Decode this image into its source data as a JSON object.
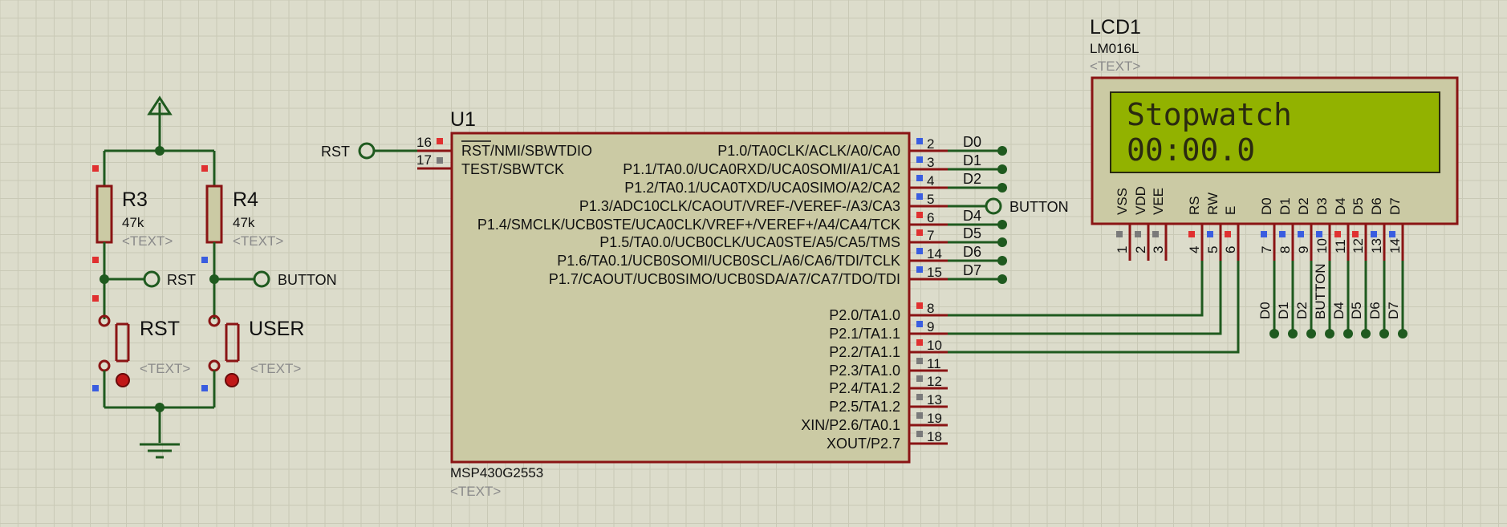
{
  "colors": {
    "background": "#dcdccb",
    "grid": "#c9c9b6",
    "wire": "#1f5a1f",
    "component_outline": "#8a1414",
    "component_body": "#cbcaa4",
    "lcd_screen": "#92b200",
    "lcd_text": "#2a2a10",
    "pin_red": "#e03030",
    "pin_blue": "#3a5de0",
    "pin_gray": "#7a7a7a"
  },
  "power_terminal_icon": "up-arrow-icon",
  "ground_icon": "ground-icon",
  "resistors": [
    {
      "ref": "R3",
      "value": "47k",
      "text_placeholder": "<TEXT>"
    },
    {
      "ref": "R4",
      "value": "47k",
      "text_placeholder": "<TEXT>"
    }
  ],
  "buttons": [
    {
      "ref": "RST",
      "text_placeholder": "<TEXT>"
    },
    {
      "ref": "USER",
      "text_placeholder": "<TEXT>"
    }
  ],
  "left_terminals": [
    {
      "label": "RST"
    },
    {
      "label": "BUTTON"
    }
  ],
  "mcu": {
    "ref": "U1",
    "part": "MSP430G2553",
    "text_placeholder": "<TEXT>",
    "input_terminal": "RST",
    "left_pins": [
      {
        "num": "16",
        "name": "RST/NMI/SBWTDIO",
        "overline": "RST",
        "rest": "/NMI/SBWTDIO"
      },
      {
        "num": "17",
        "name": "TEST/SBWTCK"
      }
    ],
    "right_pins": [
      {
        "num": "2",
        "name": "P1.0/TA0CLK/ACLK/A0/CA0",
        "net": "D0"
      },
      {
        "num": "3",
        "name": "P1.1/TA0.0/UCA0RXD/UCA0SOMI/A1/CA1",
        "net": "D1"
      },
      {
        "num": "4",
        "name": "P1.2/TA0.1/UCA0TXD/UCA0SIMO/A2/CA2",
        "net": "D2"
      },
      {
        "num": "5",
        "name": "P1.3/ADC10CLK/CAOUT/VREF-/VEREF-/A3/CA3",
        "net": "BUTTON"
      },
      {
        "num": "6",
        "name": "P1.4/SMCLK/UCB0STE/UCA0CLK/VREF+/VEREF+/A4/CA4/TCK",
        "net": "D4"
      },
      {
        "num": "7",
        "name": "P1.5/TA0.0/UCB0CLK/UCA0STE/A5/CA5/TMS",
        "net": "D5"
      },
      {
        "num": "14",
        "name": "P1.6/TA0.1/UCB0SOMI/UCB0SCL/A6/CA6/TDI/TCLK",
        "net": "D6"
      },
      {
        "num": "15",
        "name": "P1.7/CAOUT/UCB0SIMO/UCB0SDA/A7/CA7/TDO/TDI",
        "net": "D7"
      },
      {
        "num": "8",
        "name": "P2.0/TA1.0",
        "net": ""
      },
      {
        "num": "9",
        "name": "P2.1/TA1.1",
        "net": ""
      },
      {
        "num": "10",
        "name": "P2.2/TA1.1",
        "net": ""
      },
      {
        "num": "11",
        "name": "P2.3/TA1.0",
        "net": ""
      },
      {
        "num": "12",
        "name": "P2.4/TA1.2",
        "net": ""
      },
      {
        "num": "13",
        "name": "P2.5/TA1.2",
        "net": ""
      },
      {
        "num": "19",
        "name": "XIN/P2.6/TA0.1",
        "net": ""
      },
      {
        "num": "18",
        "name": "XOUT/P2.7",
        "net": ""
      }
    ]
  },
  "lcd": {
    "ref": "LCD1",
    "part": "LM016L",
    "text_placeholder": "<TEXT>",
    "line1": "Stopwatch",
    "line2": "00:00.0",
    "pins": [
      {
        "num": "1",
        "name": "VSS",
        "net": ""
      },
      {
        "num": "2",
        "name": "VDD",
        "net": ""
      },
      {
        "num": "3",
        "name": "VEE",
        "net": ""
      },
      {
        "num": "4",
        "name": "RS",
        "net": ""
      },
      {
        "num": "5",
        "name": "RW",
        "net": ""
      },
      {
        "num": "6",
        "name": "E",
        "net": ""
      },
      {
        "num": "7",
        "name": "D0",
        "net": "D0"
      },
      {
        "num": "8",
        "name": "D1",
        "net": "D1"
      },
      {
        "num": "9",
        "name": "D2",
        "net": "D2"
      },
      {
        "num": "10",
        "name": "D3",
        "net": "BUTTON"
      },
      {
        "num": "11",
        "name": "D4",
        "net": "D4"
      },
      {
        "num": "12",
        "name": "D5",
        "net": "D5"
      },
      {
        "num": "13",
        "name": "D6",
        "net": "D6"
      },
      {
        "num": "14",
        "name": "D7",
        "net": "D7"
      }
    ]
  }
}
